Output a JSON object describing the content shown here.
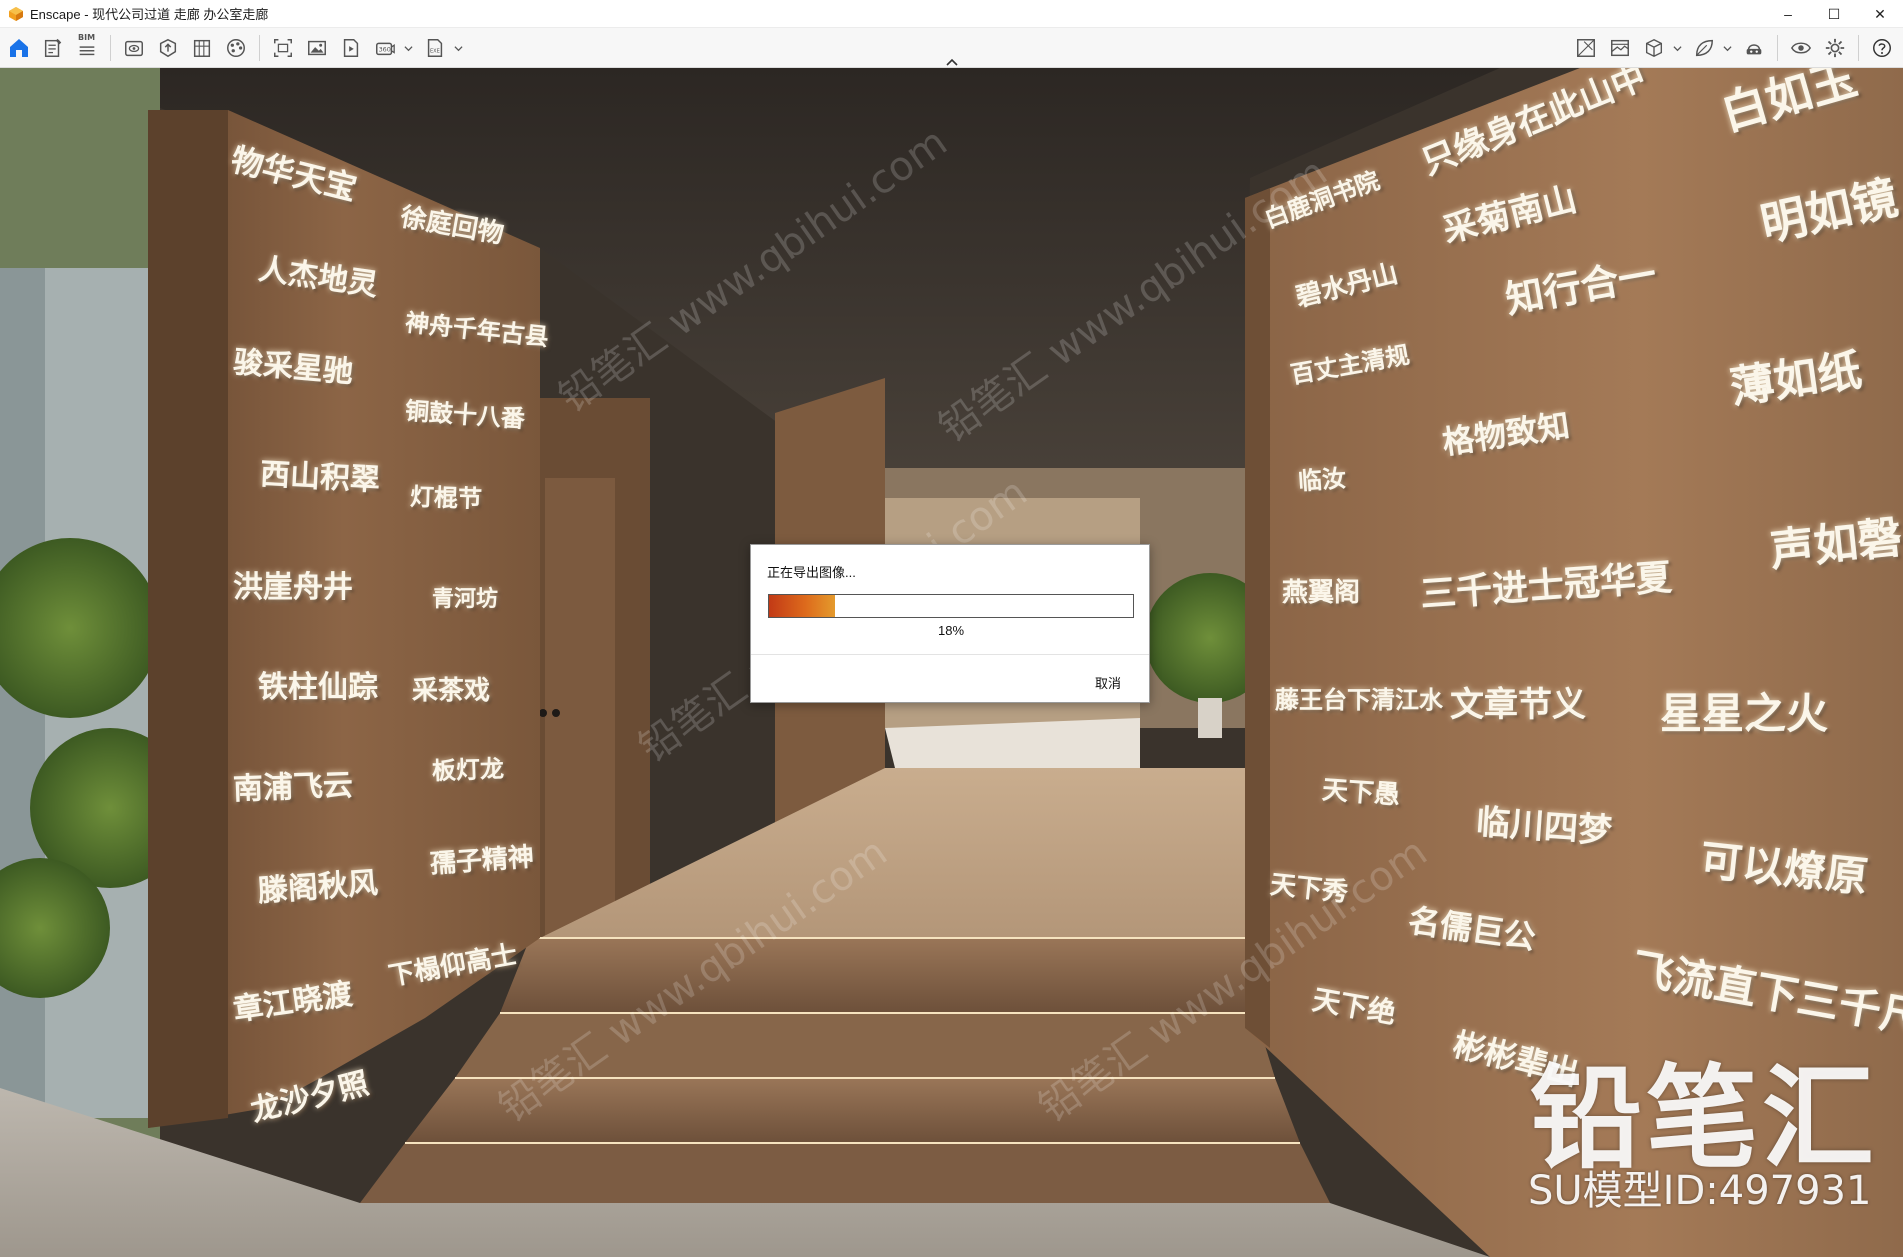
{
  "window": {
    "title": "Enscape - 现代公司过道 走廊 办公室走廊",
    "minimize_glyph": "–",
    "maximize_glyph": "☐",
    "close_glyph": "✕"
  },
  "toolbar": {
    "bim_label": "BIM",
    "left_icons": [
      "home-icon",
      "document-icon",
      "bim-info-icon",
      "visibility-icon",
      "upload-icon",
      "building-icon",
      "color-palette-icon",
      "screenshot-icon",
      "image-export-icon",
      "video-export-icon",
      "panorama-360-icon",
      "exe-export-icon"
    ],
    "right_icons": [
      "asset-library-icon",
      "material-editor-icon",
      "cube-icon",
      "leaf-icon",
      "vr-headset-icon",
      "eye-icon",
      "settings-icon",
      "help-icon"
    ]
  },
  "dialog": {
    "title": "正在导出图像...",
    "progress": 0.18,
    "percent_label": "18%",
    "cancel_label": "取消",
    "accent_color": "#dd6a1c"
  },
  "scene": {
    "left_wall_text": [
      "物华天宝",
      "徐庭回物",
      "人杰地灵",
      "神舟千年古县",
      "骏采星驰",
      "铜鼓十八番",
      "西山积翠",
      "灯棍节",
      "洪崖舟井",
      "青河坊",
      "铁柱仙踪",
      "采茶戏",
      "南浦飞云",
      "板灯龙",
      "滕阁秋风",
      "孺子精神",
      "章江晓渡",
      "下榻仰高士",
      "龙沙夕照"
    ],
    "right_wall_text": [
      "只缘身在此山中",
      "白如玉",
      "白鹿洞书院",
      "采菊南山",
      "明如镜",
      "碧水丹山",
      "知行合一",
      "百丈主清规",
      "薄如纸",
      "格物致知",
      "临汝",
      "声如磬",
      "燕翼阁",
      "三千进士冠华夏",
      "藤王台下清江水",
      "文章节义",
      "星星之火",
      "天下愚",
      "临川四梦",
      "天下秀",
      "可以燎原",
      "名儒巨公",
      "飞流直下三千尺",
      "天下绝",
      "彬彬辈出"
    ],
    "watermark_logo": "铅笔汇",
    "watermark_id": "SU模型ID:497931",
    "watermark_tile": "铅笔汇 www.qbihui.com"
  }
}
